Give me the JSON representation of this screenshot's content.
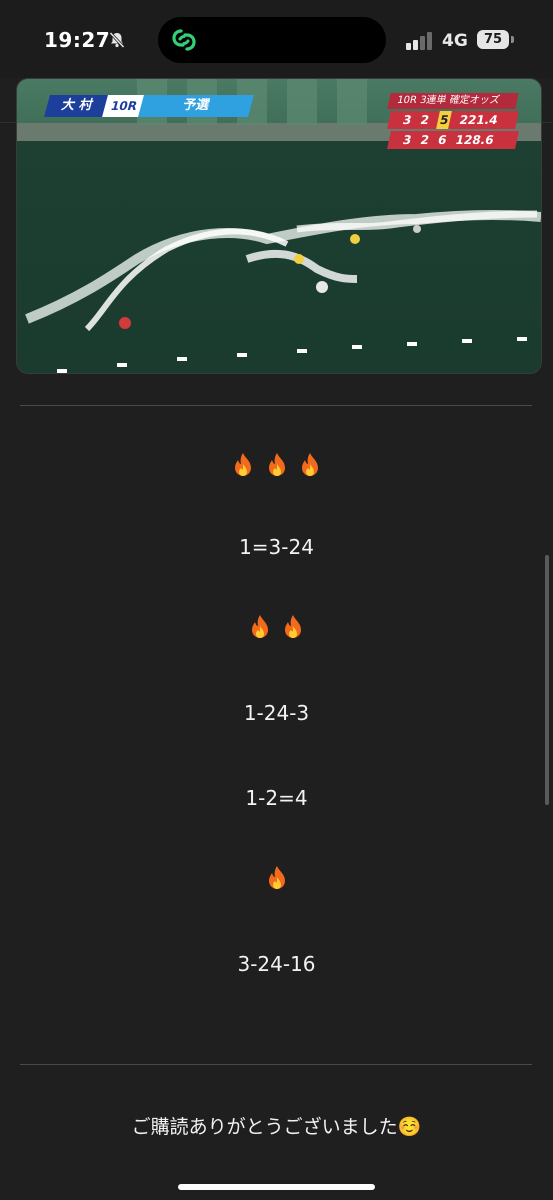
{
  "status_bar": {
    "time": "19:27",
    "network": "4G",
    "battery": "75",
    "icons": [
      "bell-slash-icon",
      "app-link-icon",
      "signal-icon",
      "battery-icon"
    ]
  },
  "video": {
    "venue": "大 村",
    "race": "10R",
    "stage": "予選",
    "odds": {
      "header_race": "10R",
      "header_label": "3連単 確定オッズ",
      "rows": [
        {
          "a": "3",
          "b": "2",
          "c": "5",
          "value": "221.4"
        },
        {
          "a": "3",
          "b": "2",
          "c": "6",
          "value": "128.6"
        }
      ]
    }
  },
  "post": {
    "lines": [
      {
        "flames": 3,
        "text": "1=3-24"
      },
      {
        "flames": 2,
        "texts": [
          "1-24-3",
          "1-2=4"
        ]
      },
      {
        "flames": 1,
        "text": "3-24-16"
      }
    ],
    "pick1": "1=3-24",
    "pick2": "1-24-3",
    "pick3": "1-2=4",
    "pick4": "3-24-16",
    "closing": "ご購読ありがとうございました☺️"
  },
  "colors": {
    "background": "#1f1f1f",
    "text": "#f2f2f2",
    "divider": "#4a4a4a",
    "accent_green": "#33d17a"
  }
}
